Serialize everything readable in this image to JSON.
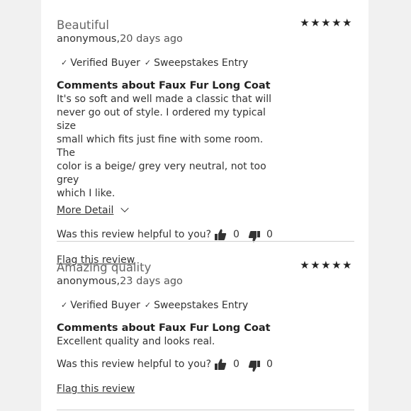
{
  "reviews": [
    {
      "title": "Beautiful",
      "author": "anonymous,",
      "ago": "20 days ago",
      "rating": 5,
      "badges": [
        "Verified Buyer",
        "Sweepstakes Entry"
      ],
      "heading": "Comments about Faux Fur Long Coat",
      "body_lines": [
        "It's so soft and well made a classic that will",
        "never go out of style. I ordered my typical size",
        "small which fits just fine with some room. The",
        "color is a beige/ grey very neutral, not too grey",
        "which I like."
      ],
      "more_label": "More Detail",
      "helpful_q": "Was this review helpful to you?",
      "up_count": "0",
      "down_count": "0",
      "flag_label": "Flag this review"
    },
    {
      "title": "Amazing quality",
      "author": "anonymous,",
      "ago": "23 days ago",
      "rating": 5,
      "badges": [
        "Verified Buyer",
        "Sweepstakes Entry"
      ],
      "heading": "Comments about Faux Fur Long Coat",
      "body_lines": [
        "Excellent quality and looks real."
      ],
      "helpful_q": "Was this review helpful to you?",
      "up_count": "0",
      "down_count": "0",
      "flag_label": "Flag this review"
    }
  ],
  "icons": {
    "check": "check-icon",
    "star": "star-icon",
    "thumbs_up": "thumbs-up-icon",
    "thumbs_down": "thumbs-down-icon",
    "chevron": "chevron-down-icon"
  }
}
